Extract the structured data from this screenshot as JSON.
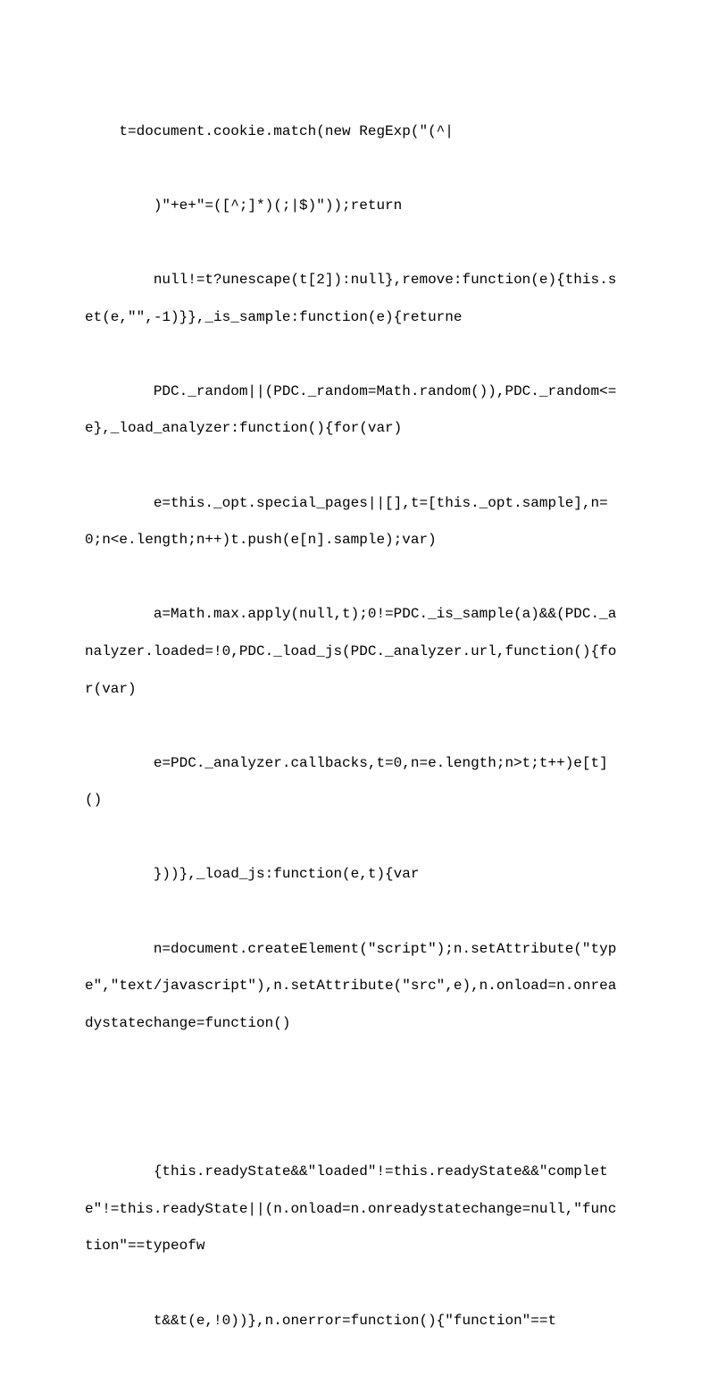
{
  "lines": [
    "t=document.cookie.match(new RegExp(\"(^|",
    "    )\"+e+\"=([^;]*)(;|$)\"));return",
    "    null!=t?unescape(t[2]):null},remove:function(e){this.set(e,\"\",-1)}},_is_sample:function(e){returne",
    "    PDC._random||(PDC._random=Math.random()),PDC._random<=e},_load_analyzer:function(){for(var)",
    "    e=this._opt.special_pages||[],t=[this._opt.sample],n=0;n<e.length;n++)t.push(e[n].sample);var)",
    "    a=Math.max.apply(null,t);0!=PDC._is_sample(a)&&(PDC._analyzer.loaded=!0,PDC._load_js(PDC._analyzer.url,function(){for(var)",
    "    e=PDC._analyzer.callbacks,t=0,n=e.length;n>t;t++)e[t]()",
    "    }))},_load_js:function(e,t){var",
    "    n=document.createElement(\"script\");n.setAttribute(\"type\",\"text/javascript\"),n.setAttribute(\"src\",e),n.onload=n.onreadystatechange=function()",
    "",
    "    {this.readyState&&\"loaded\"!=this.readyState&&\"complete\"!=this.readyState||(n.onload=n.onreadystatechange=null,\"function\"==typeofw",
    "    t&&t(e,!0))},n.onerror=function(){\"function\"==t"
  ]
}
